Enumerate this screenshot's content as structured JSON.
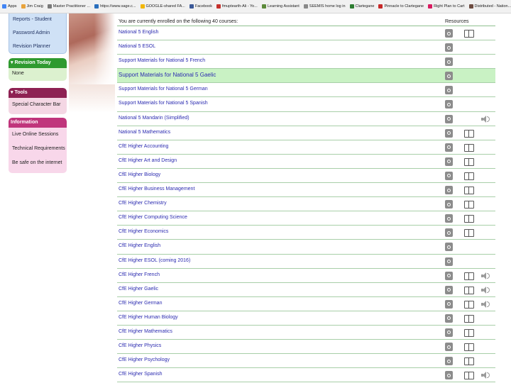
{
  "bookmarks": [
    {
      "label": "Apps",
      "color": "#4285f4"
    },
    {
      "label": "Jim Craig",
      "color": "#e8a33c"
    },
    {
      "label": "Master Practitioner ...",
      "color": "#7a7a7a"
    },
    {
      "label": "https://www.sage.c...",
      "color": "#2a6fbd"
    },
    {
      "label": "GOOGLE-shared FA...",
      "color": "#f2b705"
    },
    {
      "label": "Facebook",
      "color": "#3b5998"
    },
    {
      "label": "fmuptearth-Ali - Yo...",
      "color": "#c4302b"
    },
    {
      "label": "Learning Assistant",
      "color": "#5c8a3a"
    },
    {
      "label": "SEEMIS home log in",
      "color": "#8a8a8a"
    },
    {
      "label": "Clartegane",
      "color": "#2e7d32"
    },
    {
      "label": "Pinnacle to Clartegane",
      "color": "#c62828"
    },
    {
      "label": "Right Plan to Cart",
      "color": "#d81b60"
    },
    {
      "label": "Distributed - Nation...",
      "color": "#6d4c41"
    },
    {
      "label": "Insight Web page",
      "color": "#3949ab"
    }
  ],
  "sidebar": {
    "top_links": [
      "Reports - Student",
      "Password Admin",
      "Revision Planner"
    ],
    "panels": [
      {
        "title": "▾ Revision Today",
        "items": [
          "None"
        ],
        "style": "green"
      },
      {
        "title": "▾ Tools",
        "items": [
          "Special Character Bar"
        ],
        "style": "maroon"
      },
      {
        "title": "Information",
        "items": [
          "Live Online Sessions",
          "Technical Requirements",
          "Be safe on the internet"
        ],
        "style": "pink"
      }
    ]
  },
  "courses": {
    "intro": "You are currently enrolled on the following 40 courses:",
    "resources_header": "Resources",
    "rows": [
      {
        "name": "National 5 English",
        "book": true,
        "audio": false,
        "highlight": false
      },
      {
        "name": "National 5 ESOL",
        "book": false,
        "audio": false,
        "highlight": false
      },
      {
        "name": "Support Materials for National 5 French",
        "book": false,
        "audio": false,
        "highlight": false
      },
      {
        "name": "Support Materials for National 5 Gaelic",
        "book": false,
        "audio": false,
        "highlight": true
      },
      {
        "name": "Support Materials for National 5 German",
        "book": false,
        "audio": false,
        "highlight": false
      },
      {
        "name": "Support Materials for National 5 Spanish",
        "book": false,
        "audio": false,
        "highlight": false
      },
      {
        "name": "National 5 Mandarin (Simplified)",
        "book": false,
        "audio": true,
        "highlight": false
      },
      {
        "name": "National 5 Mathematics",
        "book": true,
        "audio": false,
        "highlight": false
      },
      {
        "name": "CfE Higher Accounting",
        "book": true,
        "audio": false,
        "highlight": false
      },
      {
        "name": "CfE Higher Art and Design",
        "book": true,
        "audio": false,
        "highlight": false
      },
      {
        "name": "CfE Higher Biology",
        "book": true,
        "audio": false,
        "highlight": false
      },
      {
        "name": "CfE Higher Business Management",
        "book": true,
        "audio": false,
        "highlight": false
      },
      {
        "name": "CfE Higher Chemistry",
        "book": true,
        "audio": false,
        "highlight": false
      },
      {
        "name": "CfE Higher Computing Science",
        "book": true,
        "audio": false,
        "highlight": false
      },
      {
        "name": "CfE Higher Economics",
        "book": true,
        "audio": false,
        "highlight": false
      },
      {
        "name": "CfE Higher English",
        "book": false,
        "audio": false,
        "highlight": false
      },
      {
        "name": "CfE Higher ESOL (coming 2016)",
        "book": false,
        "audio": false,
        "highlight": false
      },
      {
        "name": "CfE Higher French",
        "book": true,
        "audio": true,
        "highlight": false
      },
      {
        "name": "CfE Higher Gaelic",
        "book": true,
        "audio": true,
        "highlight": false
      },
      {
        "name": "CfE Higher German",
        "book": true,
        "audio": true,
        "highlight": false
      },
      {
        "name": "CfE Higher Human Biology",
        "book": true,
        "audio": false,
        "highlight": false
      },
      {
        "name": "CfE Higher Mathematics",
        "book": true,
        "audio": false,
        "highlight": false
      },
      {
        "name": "CfE Higher Physics",
        "book": true,
        "audio": false,
        "highlight": false
      },
      {
        "name": "CfE Higher Psychology",
        "book": true,
        "audio": false,
        "highlight": false
      },
      {
        "name": "CfE Higher Spanish",
        "book": true,
        "audio": true,
        "highlight": false
      }
    ]
  }
}
